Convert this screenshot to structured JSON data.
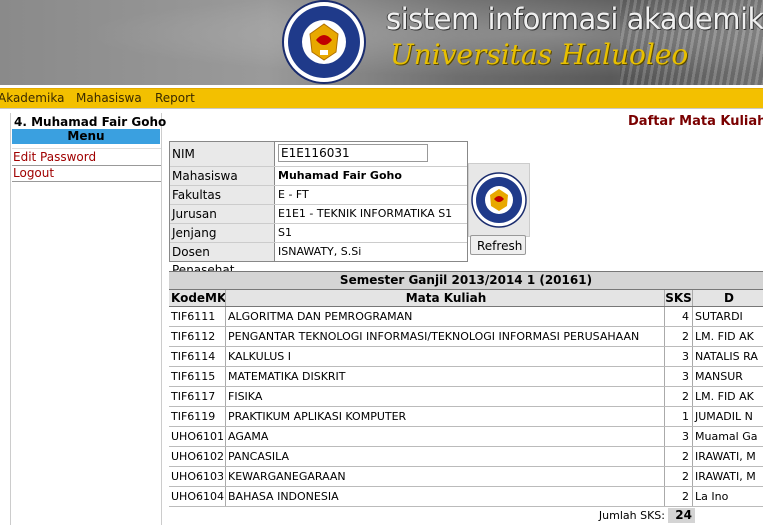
{
  "banner": {
    "title": "sistem informasi akademik",
    "subtitle": "Universitas Haluoleo",
    "logo_text_top": "UNIVERSITAS",
    "logo_text_bottom": "HALUOLEO"
  },
  "nav": {
    "items": [
      "Akademika",
      "Mahasiswa",
      "Report"
    ]
  },
  "sidebar": {
    "user_name": "4. Muhamad Fair Goho",
    "menu_header": "Menu",
    "items": [
      "Edit Password",
      "Logout"
    ]
  },
  "page_title": "Daftar Mata Kuliah y",
  "info": {
    "nim_label": "NIM",
    "nim_value": "E1E116031",
    "mahasiswa_label": "Mahasiswa",
    "mahasiswa_value": "Muhamad Fair Goho",
    "fakultas_label": "Fakultas",
    "fakultas_value": "E - FT",
    "jurusan_label": "Jurusan",
    "jurusan_value": "E1E1 - TEKNIK INFORMATIKA S1",
    "jenjang_label": "Jenjang",
    "jenjang_value": "S1",
    "dosen_label": "Dosen Penasehat",
    "dosen_value": "ISNAWATY, S.Si",
    "refresh_label": "Refresh"
  },
  "courses": {
    "semester": "Semester Ganjil 2013/2014 1 (20161)",
    "headers": [
      "KodeMK",
      "Mata Kuliah",
      "SKS",
      "D"
    ],
    "rows": [
      {
        "kode": "TIF6111",
        "nama": "ALGORITMA DAN PEMROGRAMAN",
        "sks": "4",
        "dosen": "SUTARDI"
      },
      {
        "kode": "TIF6112",
        "nama": "PENGANTAR TEKNOLOGI INFORMASI/TEKNOLOGI INFORMASI PERUSAHAAN",
        "sks": "2",
        "dosen": "LM. FID AK"
      },
      {
        "kode": "TIF6114",
        "nama": "KALKULUS I",
        "sks": "3",
        "dosen": "NATALIS RA"
      },
      {
        "kode": "TIF6115",
        "nama": "MATEMATIKA DISKRIT",
        "sks": "3",
        "dosen": "MANSUR"
      },
      {
        "kode": "TIF6117",
        "nama": "FISIKA",
        "sks": "2",
        "dosen": "LM. FID AK"
      },
      {
        "kode": "TIF6119",
        "nama": "PRAKTIKUM APLIKASI KOMPUTER",
        "sks": "1",
        "dosen": "JUMADIL N"
      },
      {
        "kode": "UHO6101",
        "nama": "AGAMA",
        "sks": "3",
        "dosen": "Muamal Ga"
      },
      {
        "kode": "UHO6102",
        "nama": "PANCASILA",
        "sks": "2",
        "dosen": "IRAWATI, M"
      },
      {
        "kode": "UHO6103",
        "nama": "KEWARGANEGARAAN",
        "sks": "2",
        "dosen": "IRAWATI, M"
      },
      {
        "kode": "UHO6104",
        "nama": "BAHASA INDONESIA",
        "sks": "2",
        "dosen": "La Ino"
      }
    ],
    "total_label": "Jumlah SKS:",
    "total_value": "24"
  },
  "colors": {
    "nav_bg": "#f3c000",
    "menu_header_bg": "#3aa0e0",
    "link_color": "#a00000",
    "title_color": "#7a0000"
  },
  "icons": [
    "university-logo",
    "student-photo-logo"
  ]
}
